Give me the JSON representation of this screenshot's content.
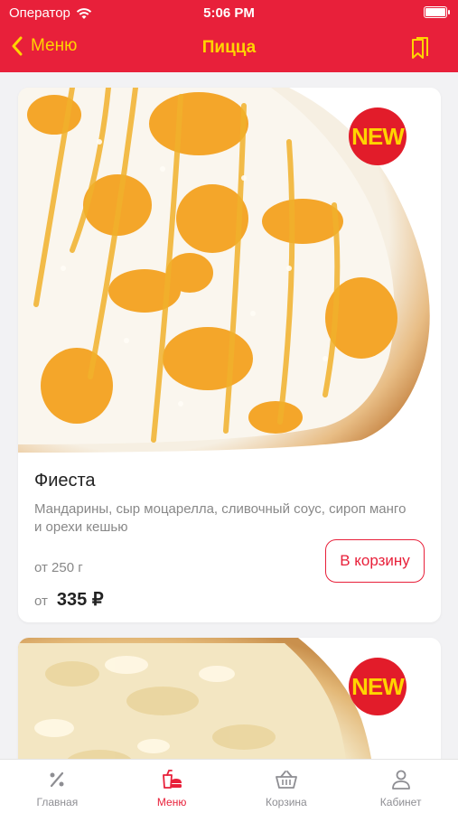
{
  "status_bar": {
    "carrier": "Оператор",
    "time": "5:06 PM"
  },
  "nav": {
    "back_label": "Меню",
    "title": "Пицца"
  },
  "products": [
    {
      "badge": "NEW",
      "name": "Фиеста",
      "description": "Мандарины, сыр моцарелла, сливочный соус, сироп манго и орехи кешью",
      "weight": "от 250 г",
      "price_prefix": "от",
      "price": "335 ₽",
      "cart_label": "В корзину"
    },
    {
      "badge": "NEW"
    }
  ],
  "tabbar": {
    "items": [
      {
        "label": "Главная",
        "icon": "percent-icon"
      },
      {
        "label": "Меню",
        "icon": "food-menu-icon",
        "active": true
      },
      {
        "label": "Корзина",
        "icon": "basket-icon"
      },
      {
        "label": "Кабинет",
        "icon": "profile-icon"
      }
    ]
  },
  "colors": {
    "brand_red": "#e8203a",
    "accent_yellow": "#ffd400",
    "badge_red": "#e21c2a"
  }
}
